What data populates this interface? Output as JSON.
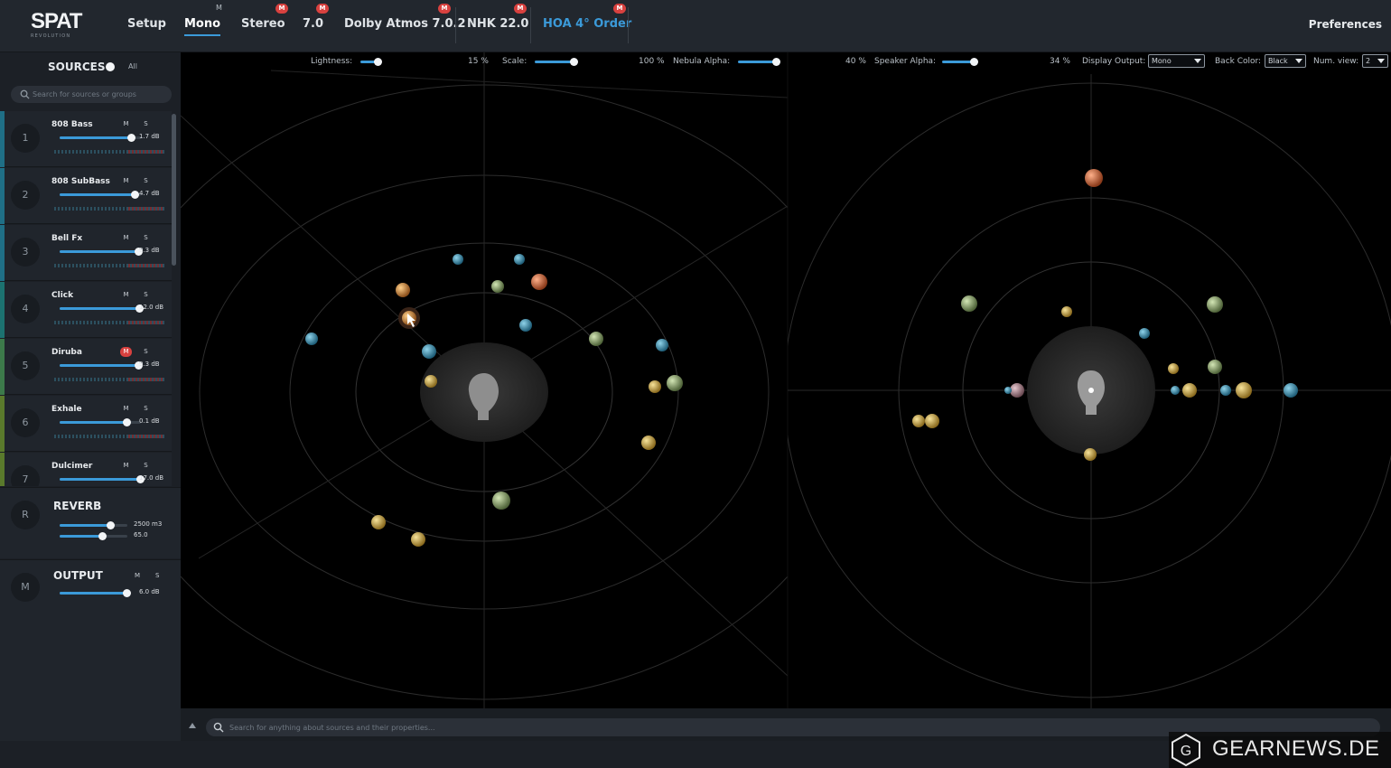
{
  "app": {
    "logo_text": "SPAT",
    "logo_sub": "REVOLUTION",
    "preferences_label": "Preferences"
  },
  "tabs": [
    {
      "label": "Setup",
      "active": false,
      "badge": ""
    },
    {
      "label": "Mono",
      "active": true,
      "badge": "M"
    },
    {
      "label": "Stereo",
      "active": false,
      "badge": "M"
    },
    {
      "label": "7.0",
      "active": false,
      "badge": "M"
    },
    {
      "label": "Dolby Atmos 7.0.2",
      "active": false,
      "badge": "M"
    },
    {
      "label": "NHK 22.0",
      "active": false,
      "badge": "M"
    },
    {
      "label": "HOA 4° Order",
      "active": false,
      "badge": "M"
    }
  ],
  "sidebar": {
    "title": "SOURCES",
    "all_label": "All",
    "search_placeholder": "Search for sources or groups",
    "mute_label": "M",
    "solo_label": "S",
    "tracks": [
      {
        "num": "1",
        "name": "808 Bass",
        "db": "1.7 dB",
        "level": 0.88,
        "muted": false,
        "color": "#1f6f86"
      },
      {
        "num": "2",
        "name": "808 SubBass",
        "db": "4.7 dB",
        "level": 0.92,
        "muted": false,
        "color": "#1f6f86"
      },
      {
        "num": "3",
        "name": "Bell Fx",
        "db": "9.3 dB",
        "level": 0.97,
        "muted": false,
        "color": "#1f6f86"
      },
      {
        "num": "4",
        "name": "Click",
        "db": "12.0 dB",
        "level": 0.98,
        "muted": false,
        "color": "#1c7270"
      },
      {
        "num": "5",
        "name": "Diruba",
        "db": "9.3 dB",
        "level": 0.97,
        "muted": true,
        "color": "#3c7a4a"
      },
      {
        "num": "6",
        "name": "Exhale",
        "db": "0.1 dB",
        "level": 0.82,
        "muted": false,
        "color": "#5a7a2c"
      },
      {
        "num": "7",
        "name": "Dulcimer",
        "db": "17.0 dB",
        "level": 0.99,
        "muted": false,
        "color": "#5a7a2c"
      }
    ],
    "reverb": {
      "num": "R",
      "title": "REVERB",
      "value1": "2500 m3",
      "value2": "65.0",
      "level1": 0.75,
      "level2": 0.62
    },
    "output": {
      "num": "M",
      "title": "OUTPUT",
      "db": "6.0 dB",
      "level": 0.99
    }
  },
  "controls": {
    "lightness_label": "Lightness:",
    "lightness_value": "15 %",
    "scale_label": "Scale:",
    "scale_value": "100 %",
    "nebula_label": "Nebula Alpha:",
    "nebula_value": "40 %",
    "speaker_label": "Speaker Alpha:",
    "speaker_value": "34 %",
    "display_output_label": "Display Output:",
    "display_output_value": "Mono",
    "back_color_label": "Back Color:",
    "back_color_value": "Black",
    "num_view_label": "Num. view:",
    "num_view_value": "2"
  },
  "bottom": {
    "search_placeholder": "Search for anything about sources and their properties..."
  },
  "watermark": {
    "letter": "G",
    "text": "GEARNEWS.DE"
  },
  "colors": {
    "accent": "#3b9ad9",
    "mute_red": "#d8413f",
    "panel": "#1c2026",
    "topbar": "#22272e"
  }
}
